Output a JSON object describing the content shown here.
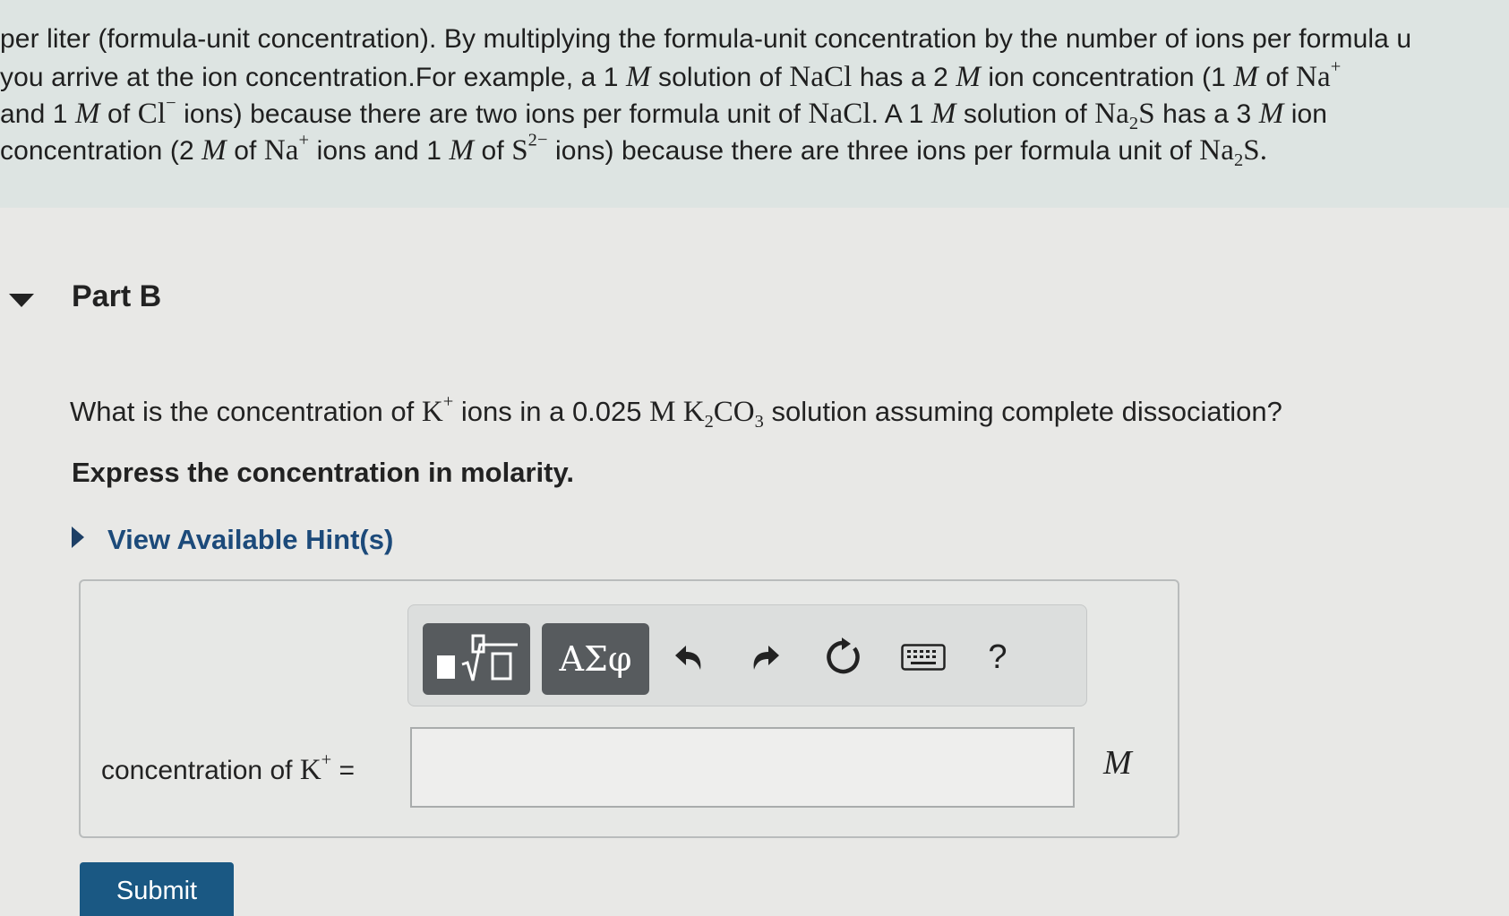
{
  "intro": {
    "line1": "per liter (formula-unit concentration). By multiplying the formula-unit concentration by the number of ions per formula u",
    "line2_a": "you arrive at the ion concentration.For example, a 1 ",
    "line2_b": " solution of ",
    "line2_c": " has a 2 ",
    "line2_d": " ion concentration (1 ",
    "line2_e": " of ",
    "line3_a": "and 1 ",
    "line3_b": " of ",
    "line3_c": " ions) because there are two ions per formula unit of ",
    "line3_d": ". A 1 ",
    "line3_e": " solution of ",
    "line3_f": " has a 3 ",
    "line3_g": " ion",
    "line4_a": "concentration (2 ",
    "line4_b": " of ",
    "line4_c": " ions and 1 ",
    "line4_d": " of ",
    "line4_e": " ions) because there are three ions per formula unit of ",
    "sym_M": "M",
    "sym_NaCl": "NaCl",
    "sym_Na": "Na",
    "sym_Cl": "Cl",
    "sym_S": "S",
    "sym_2": "2",
    "sym_plus": "+",
    "sym_minus": "−",
    "sym_2minus": "2−",
    "period": "."
  },
  "part_b": {
    "title": "Part B",
    "question_a": "What is the concentration of ",
    "question_b": " ions in a 0.025 ",
    "question_c": " solution assuming complete dissociation?",
    "sym_K": "K",
    "sym_M": "M",
    "sym_CO": "CO",
    "sym_3": "3",
    "instruction": "Express the concentration in molarity.",
    "hint_link": "View Available Hint(s)"
  },
  "toolbar": {
    "templates_icon": "templates-radical-icon",
    "greek_label": "ΑΣφ",
    "undo_icon": "undo-icon",
    "redo_icon": "redo-icon",
    "reset_icon": "reset-icon",
    "keyboard_icon": "keyboard-icon",
    "help_label": "?"
  },
  "answer": {
    "label": "concentration of ",
    "equals": " =",
    "value": "",
    "unit": "M"
  },
  "submit_label": "Submit"
}
